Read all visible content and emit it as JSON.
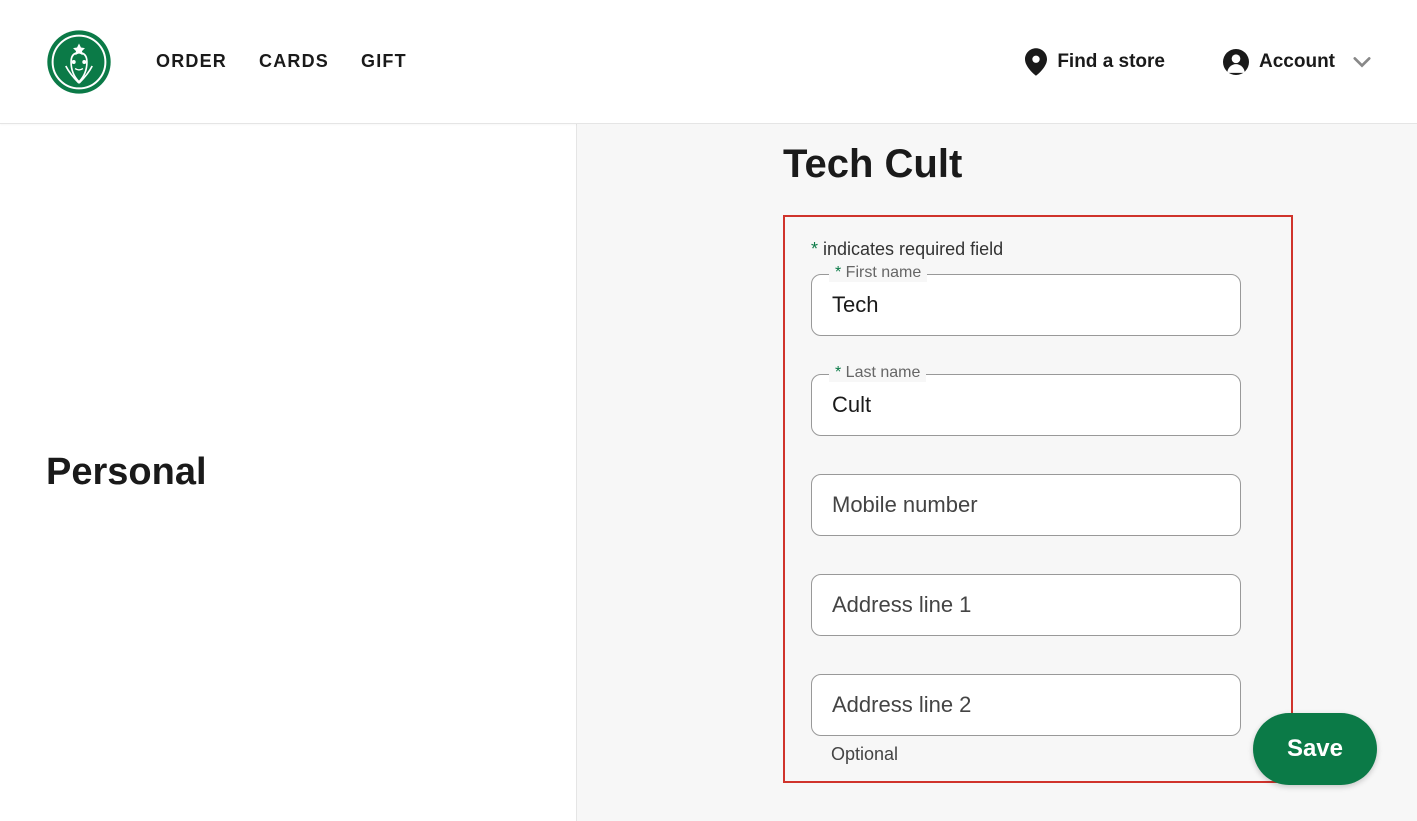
{
  "header": {
    "nav": [
      "ORDER",
      "CARDS",
      "GIFT"
    ],
    "find_store": "Find a store",
    "account": "Account"
  },
  "left": {
    "title": "Personal"
  },
  "main": {
    "display_name": "Tech Cult",
    "required_note_prefix": "*",
    "required_note": " indicates required field",
    "fields": {
      "first_name": {
        "label": "First name",
        "value": "Tech"
      },
      "last_name": {
        "label": "Last name",
        "value": "Cult"
      },
      "mobile": {
        "placeholder": "Mobile number",
        "value": ""
      },
      "address1": {
        "placeholder": "Address line 1",
        "value": ""
      },
      "address2": {
        "placeholder": "Address line 2",
        "value": "",
        "helper": "Optional"
      }
    }
  },
  "actions": {
    "save": "Save"
  }
}
